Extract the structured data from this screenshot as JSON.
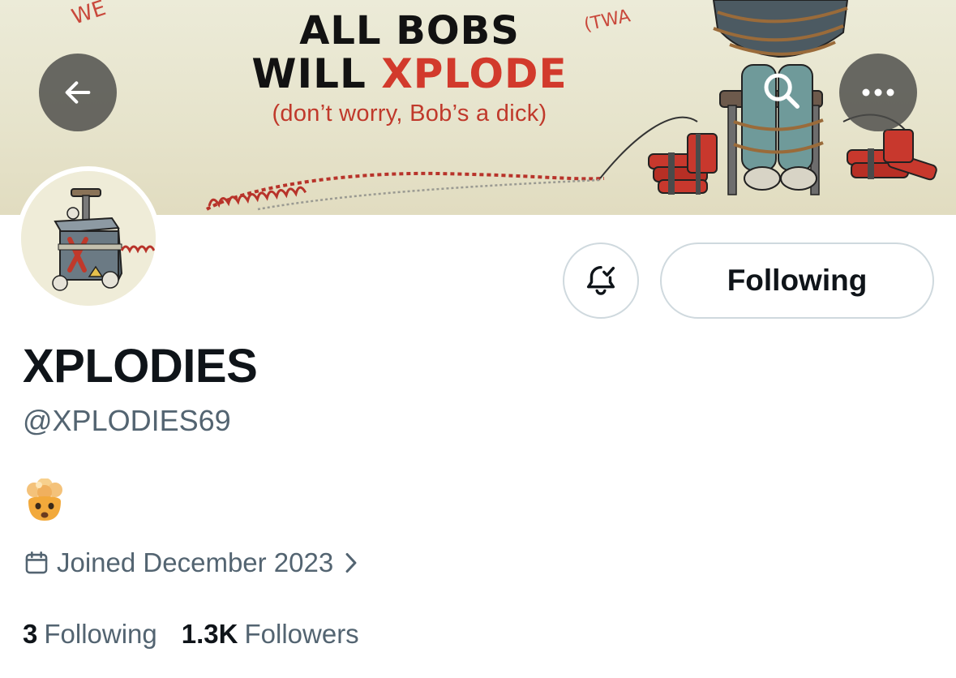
{
  "banner": {
    "headline_line1": "ALL BOBS",
    "headline_line2_black": "WILL ",
    "headline_line2_red": "XPLODE",
    "subtitle": "(don’t worry, Bob’s a dick)",
    "scrawl_left": "WE",
    "scrawl_right": "(TWA",
    "colors": {
      "background": "#e6e3cb",
      "headline": "#121212",
      "accent": "#d23a2c"
    }
  },
  "header_buttons": {
    "back_icon": "arrow-left-icon",
    "search_icon": "search-icon",
    "more_icon": "more-horizontal-icon"
  },
  "profile": {
    "display_name": "XPLODIES",
    "handle": "@XPLODIES69",
    "bio_emoji": "exploding-head-icon",
    "joined": "Joined December 2023",
    "following_count": "3",
    "following_label": "Following",
    "followers_count": "1.3K",
    "followers_label": "Followers"
  },
  "actions": {
    "notifications_icon": "bell-check-icon",
    "follow_button_label": "Following"
  },
  "colors": {
    "text_primary": "#0f1419",
    "text_secondary": "#536471",
    "border": "#cfd9de"
  }
}
